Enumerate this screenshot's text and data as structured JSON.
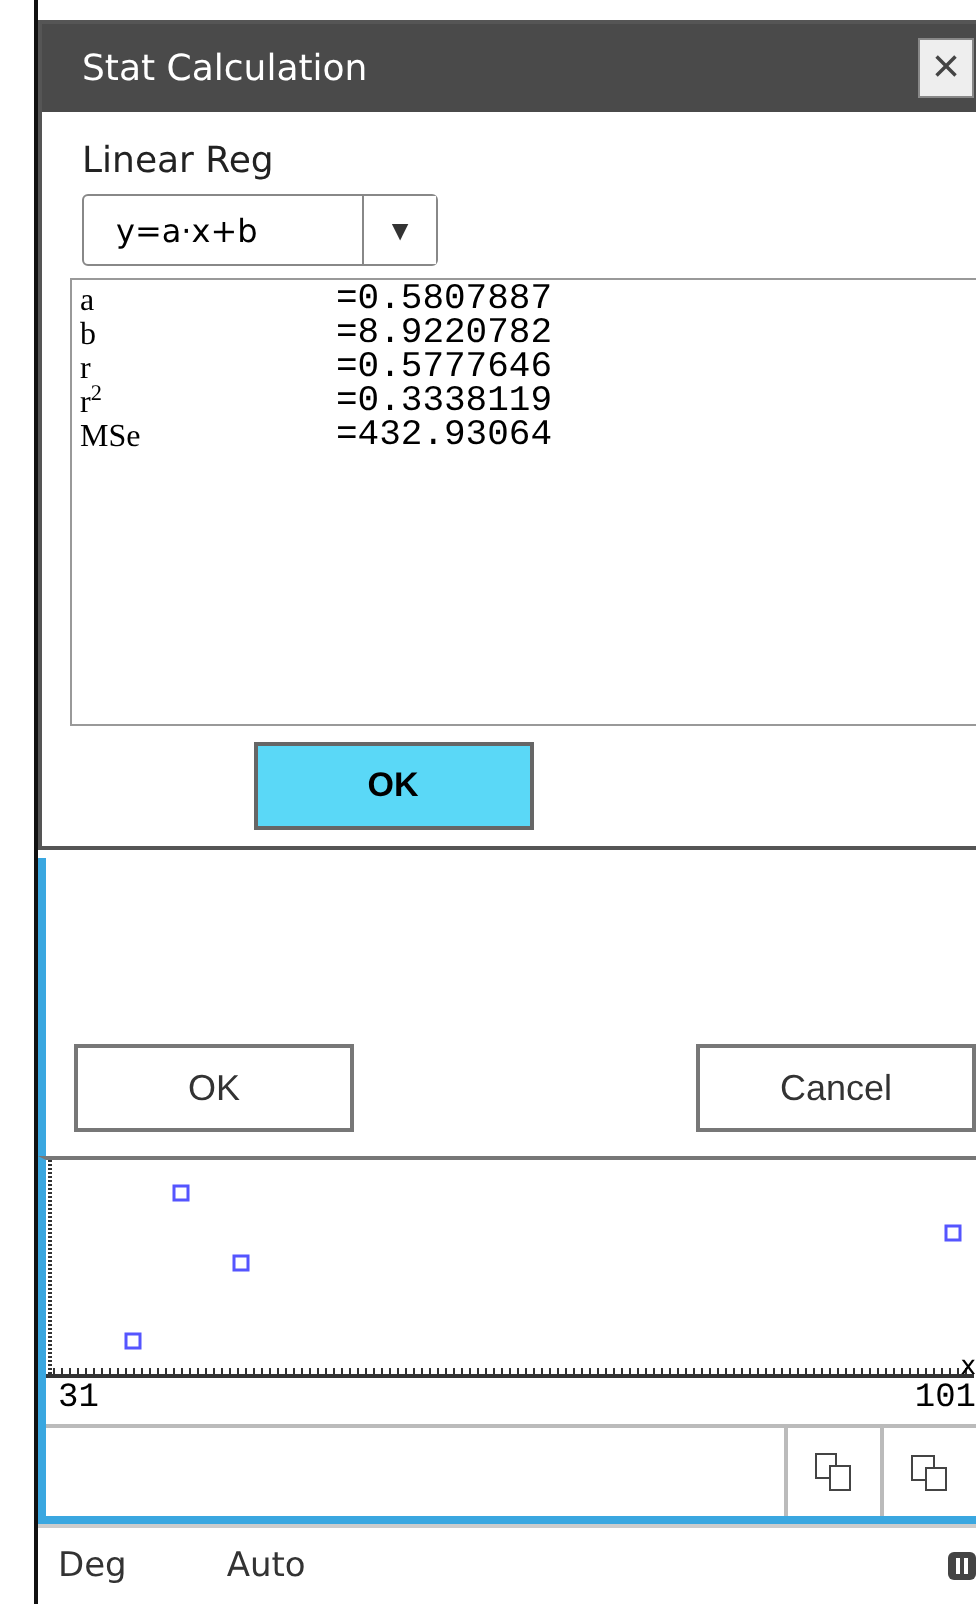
{
  "dialog": {
    "title": "Stat Calculation",
    "close": "×",
    "calc_type": "Linear Reg",
    "formula": {
      "value": "y=a·x+b",
      "arrow": "▼"
    },
    "results": [
      {
        "name": "a",
        "value": "=0.5807887"
      },
      {
        "name": "b",
        "value": "=8.9220782"
      },
      {
        "name": "r",
        "value": "=0.5777646"
      },
      {
        "name": "r$^{2}$",
        "value": "=0.3338119"
      },
      {
        "name": "MSe",
        "value": "=432.93064"
      }
    ],
    "ok": "OK"
  },
  "form_buttons": [
    {
      "label": "OK"
    },
    {
      "label": "Cancel"
    }
  ],
  "graph": {
    "x_min": "31",
    "x_max": "101",
    "x_axis": "x"
  },
  "status_bar": {
    "angle": "Deg",
    "mode": "Auto"
  }
}
